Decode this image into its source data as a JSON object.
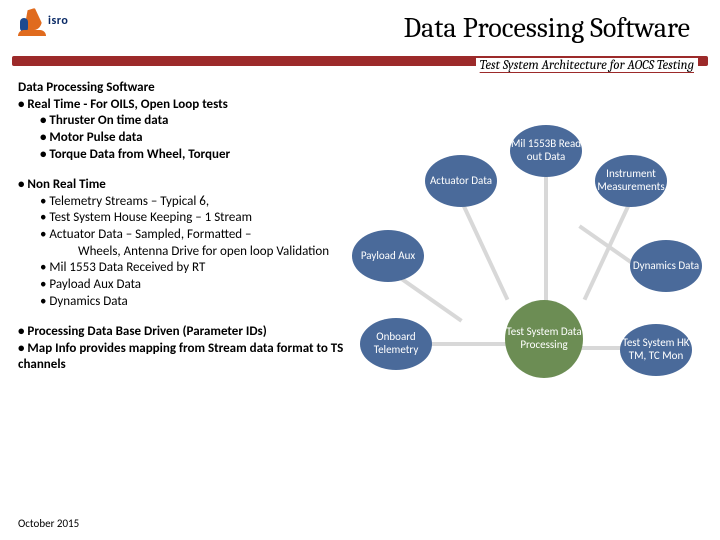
{
  "header": {
    "logo_text": "isro",
    "title": "Data Processing Software",
    "subtitle": "Test System Architecture for AOCS Testing"
  },
  "section_heading": "Data Processing Software",
  "realtime": {
    "head": "• Real Time  - For OILS, Open Loop tests",
    "items": [
      "• Thruster On time data",
      "• Motor Pulse data",
      "• Torque Data from Wheel, Torquer"
    ]
  },
  "nonrealtime": {
    "head": "• Non Real Time",
    "items": [
      "• Telemetry Streams – Typical 6,",
      "• Test System House Keeping – 1 Stream",
      "• Actuator Data – Sampled, Formatted –",
      "Wheels, Antenna Drive for open loop Validation",
      "• Mil 1553 Data Received by RT",
      "• Payload Aux Data",
      "• Dynamics Data"
    ]
  },
  "bottom": [
    "• Processing Data Base Driven  (Parameter IDs)",
    "• Map Info provides mapping from Stream data format to TS channels"
  ],
  "date": "October 2015",
  "diagram": {
    "center": "Test System Data Processing",
    "nodes": {
      "actuator": "Actuator Data",
      "mil": "Mil 1553B Read out Data",
      "instr": "Instrument Measurements",
      "dyn": "Dynamics Data",
      "tshk": "Test System HK TM, TC Mon",
      "payload": "Payload Aux",
      "onboard": "Onboard Telemetry"
    }
  }
}
